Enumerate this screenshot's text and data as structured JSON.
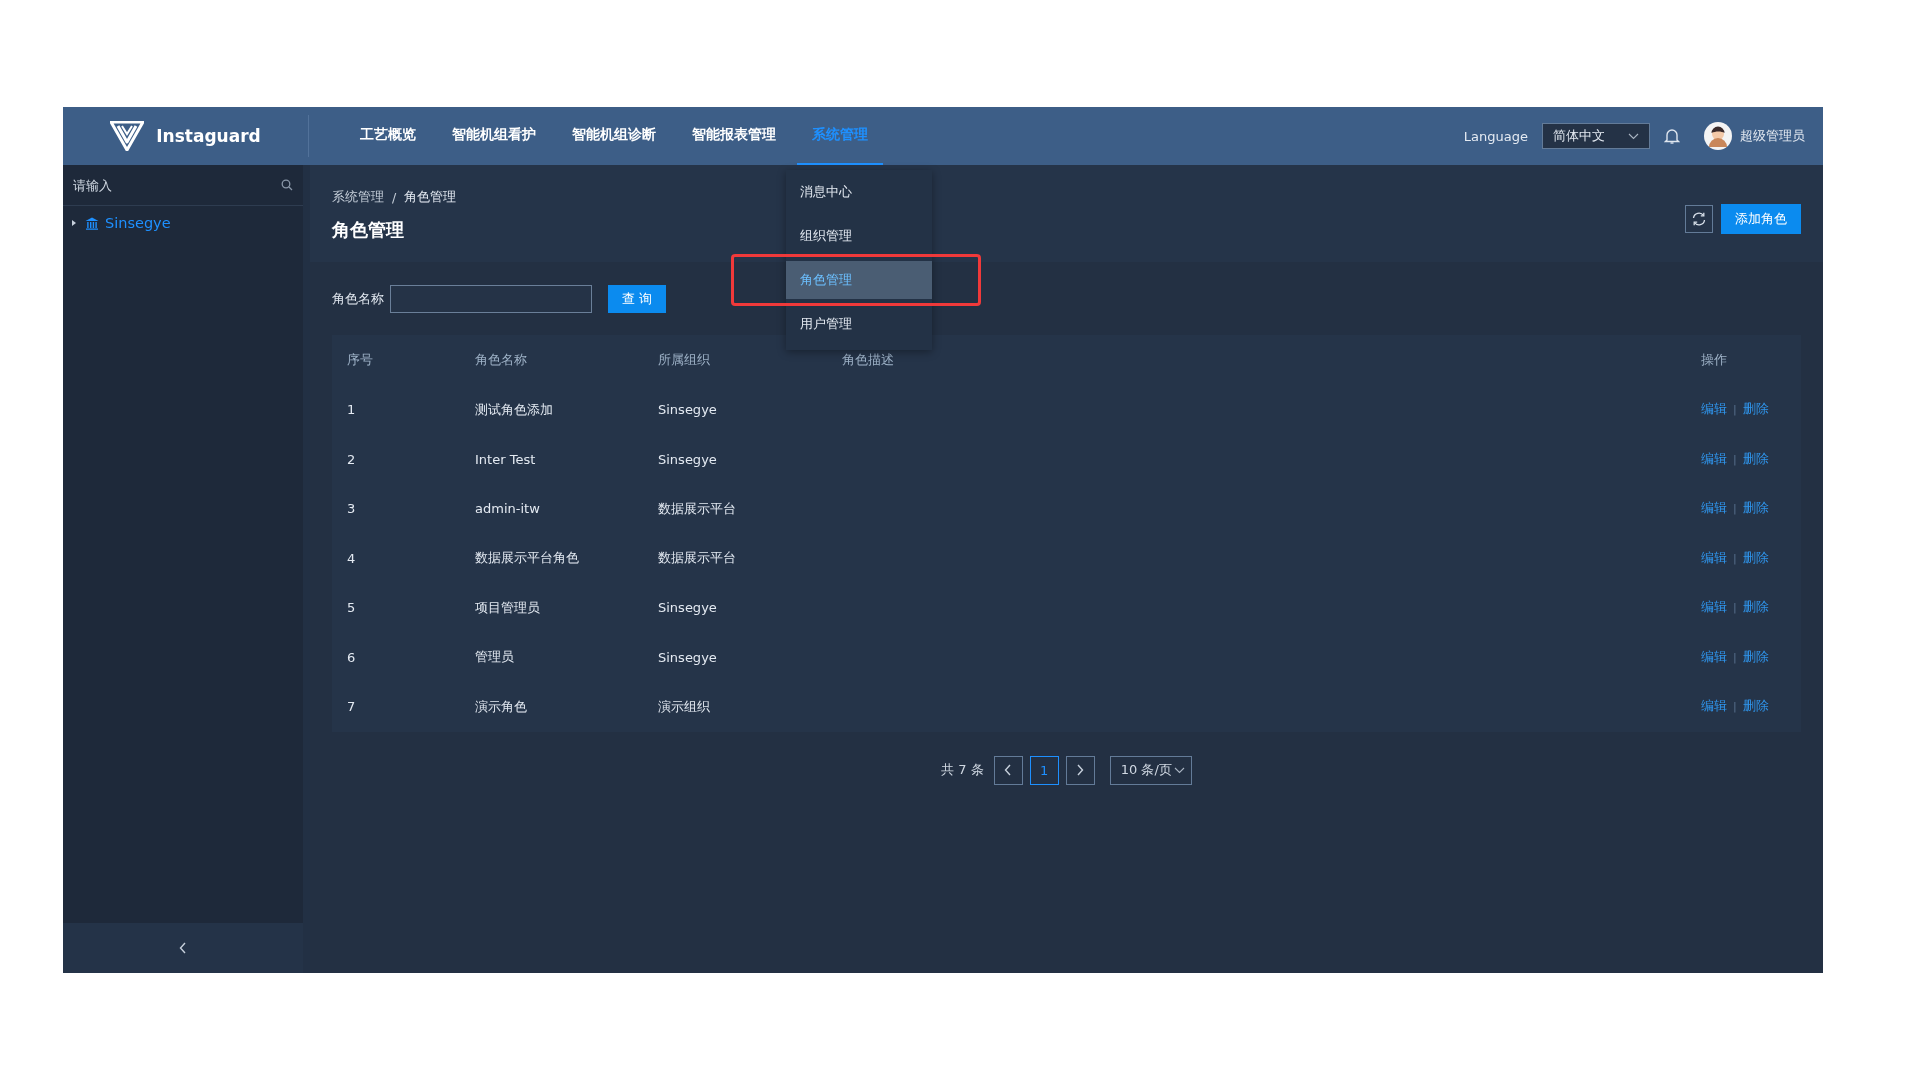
{
  "header": {
    "logo": "Instaguard",
    "nav": [
      {
        "label": "工艺概览",
        "selected": false
      },
      {
        "label": "智能机组看护",
        "selected": false
      },
      {
        "label": "智能机组诊断",
        "selected": false
      },
      {
        "label": "智能报表管理",
        "selected": false
      },
      {
        "label": "系统管理",
        "selected": true
      }
    ],
    "language_label": "Language",
    "language": "简体中文",
    "user": "超级管理员"
  },
  "nav_menu": {
    "items": [
      {
        "label": "消息中心",
        "selected": false,
        "annotated": false
      },
      {
        "label": "组织管理",
        "selected": false,
        "annotated": false
      },
      {
        "label": "角色管理",
        "selected": true,
        "annotated": true
      },
      {
        "label": "用户管理",
        "selected": false,
        "annotated": false
      }
    ]
  },
  "sidebar": {
    "search": {
      "placeholder": "请输入"
    },
    "tree": [
      {
        "label": "Sinsegye",
        "expanded": false
      }
    ]
  },
  "breadcrumb": [
    "系统管理",
    "角色管理"
  ],
  "breadcrumb_separator": "/",
  "page_title": "角色管理",
  "add_button": "添加角色",
  "filter": {
    "label": "角色名称",
    "button": "查 询"
  },
  "table": {
    "columns": [
      "序号",
      "角色名称",
      "所属组织",
      "角色描述",
      "操作"
    ],
    "action_separator": "|",
    "rows": [
      {
        "cells": [
          "1",
          "测试角色添加",
          "Sinsegye"
        ],
        "actions": [
          "编辑",
          "删除"
        ]
      },
      {
        "cells": [
          "2",
          "Inter Test",
          "Sinsegye"
        ],
        "actions": [
          "编辑",
          "删除"
        ]
      },
      {
        "cells": [
          "3",
          "admin-itw",
          "数据展示平台"
        ],
        "actions": [
          "编辑",
          "删除"
        ]
      },
      {
        "cells": [
          "4",
          "数据展示平台角色",
          "数据展示平台"
        ],
        "actions": [
          "编辑",
          "删除"
        ]
      },
      {
        "cells": [
          "5",
          "项目管理员",
          "Sinsegye"
        ],
        "actions": [
          "编辑",
          "删除"
        ]
      },
      {
        "cells": [
          "6",
          "管理员",
          "Sinsegye"
        ],
        "actions": [
          "编辑",
          "删除"
        ]
      },
      {
        "cells": [
          "7",
          "演示角色",
          "演示组织"
        ],
        "actions": [
          "编辑",
          "删除"
        ]
      }
    ]
  },
  "pagination": {
    "total": "共 7 条",
    "pages": [
      {
        "label": "1",
        "selected": true
      }
    ],
    "page_size": "10 条/页"
  }
}
